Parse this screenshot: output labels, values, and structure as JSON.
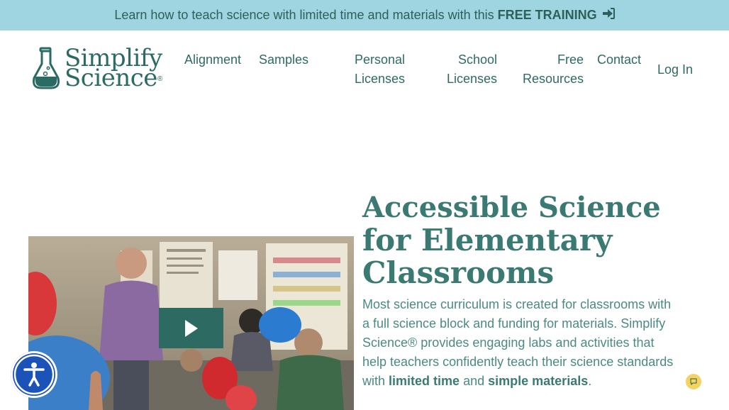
{
  "banner": {
    "text": "Learn how to teach science with limited time and materials with this",
    "cta": "FREE TRAINING"
  },
  "logo": {
    "line1": "Simplify",
    "line2": "Science",
    "mark": "®"
  },
  "nav": {
    "alignment": "Alignment",
    "samples": "Samples",
    "personal_1": "Personal",
    "personal_2": "Licenses",
    "school_1": "School",
    "school_2": "Licenses",
    "free_1": "Free",
    "free_2": "Resources",
    "contact": "Contact",
    "login": "Log In"
  },
  "hero": {
    "title_bold": "Accessible Science",
    "title_line2": "for Elementary",
    "title_line3": "Classrooms",
    "body_intro": "Most science curriculum is created for classrooms with a full science block and funding for materials. Simplify Science® provides engaging labs and activities that help teachers confidently teach their science standards with",
    "body_bold1": "limited time",
    "body_and": "and",
    "body_bold2": "simple materials",
    "body_end": "."
  },
  "icons": {
    "banner_arrow": "sign-in-arrow-icon",
    "logo": "flask-icon",
    "play": "play-icon",
    "accessibility": "accessibility-icon",
    "chat": "chat-icon"
  },
  "colors": {
    "banner_bg": "#9fd5e0",
    "brand_teal": "#2c6a64",
    "play_button": "#2d6a62",
    "accessibility_button": "#1b53b8",
    "chat_button": "#f4d35e"
  }
}
